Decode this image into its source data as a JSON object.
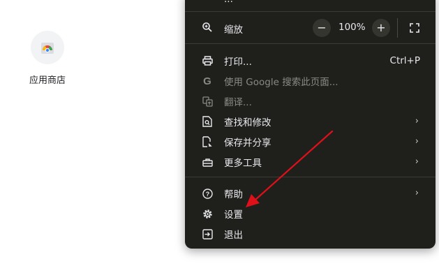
{
  "shortcut": {
    "label": "应用商店",
    "icon": "chrome-web-store-icon"
  },
  "menu": {
    "top_item": {
      "label": "...",
      "icon": "partial-item-icon"
    },
    "zoom": {
      "label": "缩放",
      "minus": "−",
      "value": "100%",
      "plus": "+",
      "icon": "zoom-icon",
      "fullscreen_icon": "fullscreen-icon"
    },
    "items": [
      {
        "label": "打印...",
        "shortcut": "Ctrl+P",
        "icon": "printer-icon"
      },
      {
        "label": "使用 Google 搜索此页面...",
        "icon": "google-icon",
        "disabled": true
      },
      {
        "label": "翻译...",
        "icon": "translate-icon",
        "disabled": true
      },
      {
        "label": "查找和修改",
        "icon": "find-edit-icon",
        "submenu": true
      },
      {
        "label": "保存并分享",
        "icon": "save-share-icon",
        "submenu": true
      },
      {
        "label": "更多工具",
        "icon": "toolbox-icon",
        "submenu": true
      },
      {
        "label": "帮助",
        "icon": "help-icon",
        "submenu": true
      },
      {
        "label": "设置",
        "icon": "settings-icon"
      },
      {
        "label": "退出",
        "icon": "exit-icon"
      }
    ],
    "submenu_chevron": "›"
  },
  "colors": {
    "menu_bg": "#1f1f1c",
    "menu_text": "#e8eaed",
    "disabled_text": "#8a8a84",
    "annotation_arrow": "#e0101a"
  }
}
